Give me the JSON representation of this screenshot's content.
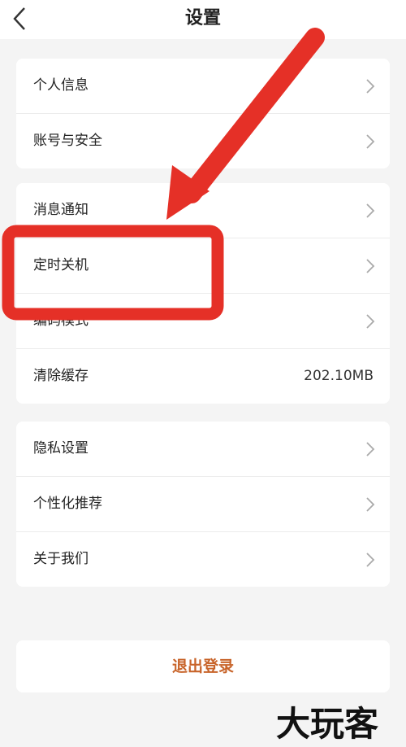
{
  "header": {
    "title": "设置"
  },
  "groups": [
    {
      "items": [
        {
          "label": "个人信息"
        },
        {
          "label": "账号与安全"
        }
      ]
    },
    {
      "items": [
        {
          "label": "消息通知"
        },
        {
          "label": "定时关机"
        },
        {
          "label": "编码模式"
        },
        {
          "label": "清除缓存",
          "value": "202.10MB"
        }
      ]
    },
    {
      "items": [
        {
          "label": "隐私设置"
        },
        {
          "label": "个性化推荐"
        },
        {
          "label": "关于我们"
        }
      ]
    }
  ],
  "logout_label": "退出登录",
  "watermark_text": "大玩客",
  "colors": {
    "logout": "#c8642a",
    "highlight": "#e53027",
    "background": "#f4f4f4"
  }
}
